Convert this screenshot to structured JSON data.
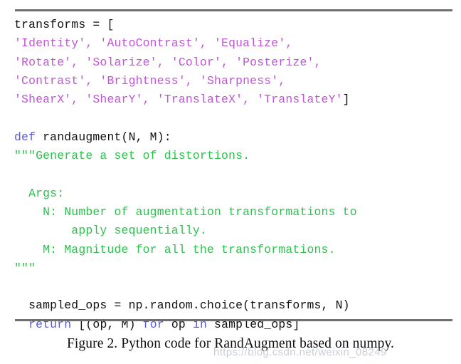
{
  "figure": {
    "caption": "Figure 2. Python code for RandAugment based on numpy.",
    "watermark": "https://blog.csdn.net/weixin_08249",
    "rule_color": "#6f6f6f"
  },
  "colors": {
    "plain": "#111111",
    "string": "#c155d8",
    "keyword": "#5a5ae0",
    "comment": "#2ec04f",
    "background": "#ffffff",
    "watermark": "#c9cfd6"
  },
  "code": {
    "language": "python",
    "lines": [
      {
        "id": "line-1",
        "indent": 0,
        "tokens": [
          {
            "text": "transforms = [",
            "type": "plain"
          }
        ]
      },
      {
        "id": "line-2",
        "indent": 0,
        "tokens": [
          {
            "text": "'Identity', 'AutoContrast', 'Equalize',",
            "type": "string"
          }
        ]
      },
      {
        "id": "line-3",
        "indent": 0,
        "tokens": [
          {
            "text": "'Rotate', 'Solarize', 'Color', 'Posterize',",
            "type": "string"
          }
        ]
      },
      {
        "id": "line-4",
        "indent": 0,
        "tokens": [
          {
            "text": "'Contrast', 'Brightness', 'Sharpness',",
            "type": "string"
          }
        ]
      },
      {
        "id": "line-5",
        "indent": 0,
        "tokens": [
          {
            "text": "'ShearX', 'ShearY', 'TranslateX', 'TranslateY'",
            "type": "string"
          },
          {
            "text": "]",
            "type": "plain"
          }
        ]
      },
      {
        "id": "line-6",
        "indent": 0,
        "tokens": [
          {
            "text": "",
            "type": "plain"
          }
        ]
      },
      {
        "id": "line-7",
        "indent": 0,
        "tokens": [
          {
            "text": "def",
            "type": "keyword"
          },
          {
            "text": " randaugment(N, M):",
            "type": "plain"
          }
        ]
      },
      {
        "id": "line-8",
        "indent": 0,
        "tokens": [
          {
            "text": "\"\"\"Generate a set of distortions.",
            "type": "comment"
          }
        ]
      },
      {
        "id": "line-9",
        "indent": 0,
        "tokens": [
          {
            "text": "",
            "type": "plain"
          }
        ]
      },
      {
        "id": "line-10",
        "indent": 0,
        "tokens": [
          {
            "text": "  Args:",
            "type": "comment"
          }
        ]
      },
      {
        "id": "line-11",
        "indent": 0,
        "tokens": [
          {
            "text": "    N: Number of augmentation transformations to",
            "type": "comment"
          }
        ]
      },
      {
        "id": "line-12",
        "indent": 0,
        "tokens": [
          {
            "text": "        apply sequentially.",
            "type": "comment"
          }
        ]
      },
      {
        "id": "line-13",
        "indent": 0,
        "tokens": [
          {
            "text": "    M: Magnitude for all the transformations.",
            "type": "comment"
          }
        ]
      },
      {
        "id": "line-14",
        "indent": 0,
        "tokens": [
          {
            "text": "\"\"\"",
            "type": "comment"
          }
        ]
      },
      {
        "id": "line-15",
        "indent": 0,
        "tokens": [
          {
            "text": "",
            "type": "plain"
          }
        ]
      },
      {
        "id": "line-16",
        "indent": 0,
        "tokens": [
          {
            "text": "  sampled_ops = np.random.choice(transforms, N)",
            "type": "plain"
          }
        ]
      },
      {
        "id": "line-17",
        "indent": 0,
        "tokens": [
          {
            "text": "  ",
            "type": "plain"
          },
          {
            "text": "return",
            "type": "keyword"
          },
          {
            "text": " [(op, M) ",
            "type": "plain"
          },
          {
            "text": "for",
            "type": "keyword"
          },
          {
            "text": " op ",
            "type": "plain"
          },
          {
            "text": "in",
            "type": "keyword"
          },
          {
            "text": " sampled_ops]",
            "type": "plain"
          }
        ]
      }
    ]
  }
}
